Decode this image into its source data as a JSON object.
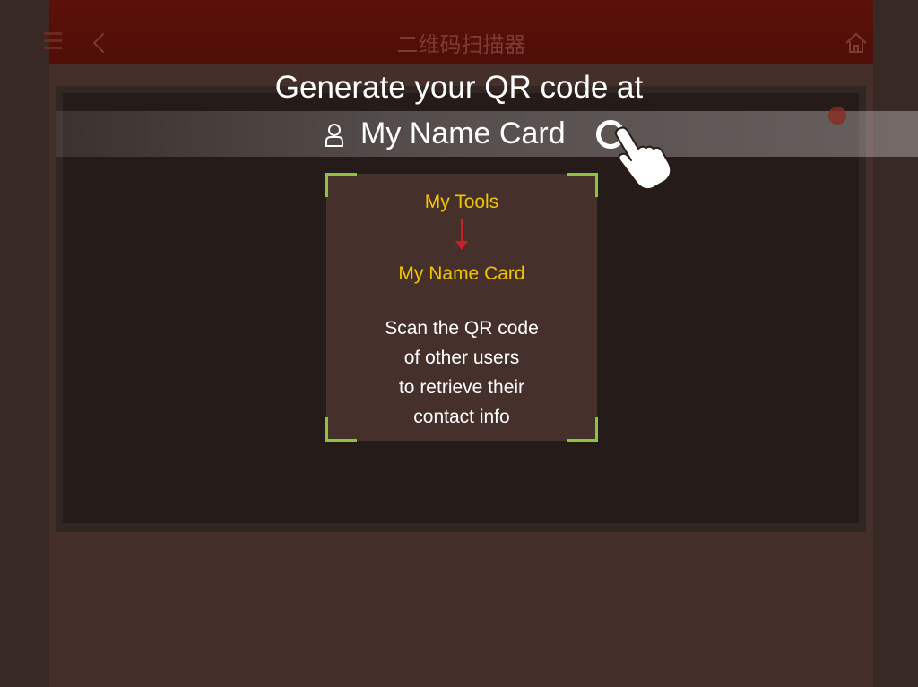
{
  "header": {
    "title": "二维码扫描器",
    "menu_icon": "menu-icon",
    "back_icon": "back-icon",
    "home_icon": "home-icon"
  },
  "banner": {
    "title": "Generate your QR code at",
    "label": "My Name Card",
    "person_icon": "person-icon",
    "action_icon": "circle-icon",
    "hand_icon": "hand-pointer-icon"
  },
  "scan_frame": {
    "step1": "My Tools",
    "step2": "My Name Card",
    "instructions": [
      "Scan the QR code",
      "of other users",
      "to retrieve their",
      "contact info"
    ]
  },
  "colors": {
    "header_bg": "#5c1108",
    "frame_corner": "#8bc53f",
    "step_text": "#f5c400",
    "arrow": "#c8202a"
  }
}
